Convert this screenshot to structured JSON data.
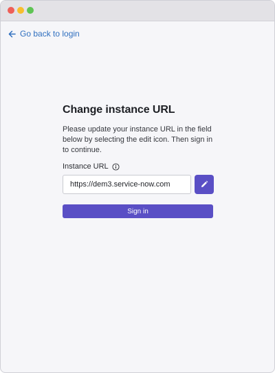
{
  "window": {
    "controls": [
      "close",
      "minimize",
      "maximize"
    ]
  },
  "nav": {
    "back_label": "Go back to login",
    "back_icon": "arrow-left-icon"
  },
  "form": {
    "title": "Change instance URL",
    "description": "Please update your instance URL in the field below by selecting the edit icon. Then sign in to continue.",
    "field_label": "Instance URL",
    "info_icon": "info-circle-icon",
    "url_value": "https://dem3.service-now.com",
    "edit_icon": "pencil-icon",
    "signin_label": "Sign in"
  },
  "colors": {
    "accent": "#5a4fc5",
    "link": "#2f6fbf",
    "background": "#f6f6f9"
  }
}
